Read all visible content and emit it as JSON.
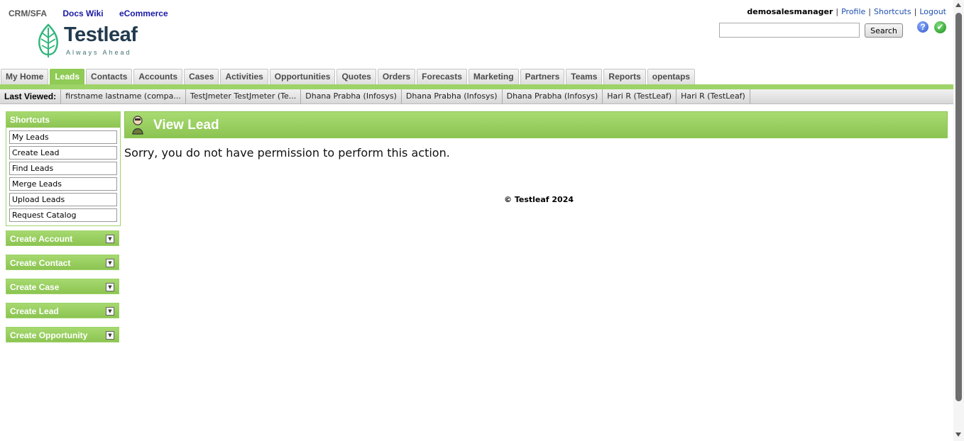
{
  "app_links": {
    "current": "CRM/SFA",
    "docs": "Docs Wiki",
    "ecommerce": "eCommerce"
  },
  "logo": {
    "name": "Testleaf",
    "tagline": "Always Ahead"
  },
  "user_menu": {
    "username": "demosalesmanager",
    "profile": "Profile",
    "shortcuts": "Shortcuts",
    "logout": "Logout",
    "separator": "|"
  },
  "search": {
    "value": "",
    "button_label": "Search"
  },
  "icons": {
    "help": "help-icon",
    "status": "check-icon",
    "help_glyph": "?",
    "status_glyph": "✔"
  },
  "tabs": [
    {
      "label": "My Home",
      "active": false
    },
    {
      "label": "Leads",
      "active": true
    },
    {
      "label": "Contacts",
      "active": false
    },
    {
      "label": "Accounts",
      "active": false
    },
    {
      "label": "Cases",
      "active": false
    },
    {
      "label": "Activities",
      "active": false
    },
    {
      "label": "Opportunities",
      "active": false
    },
    {
      "label": "Quotes",
      "active": false
    },
    {
      "label": "Orders",
      "active": false
    },
    {
      "label": "Forecasts",
      "active": false
    },
    {
      "label": "Marketing",
      "active": false
    },
    {
      "label": "Partners",
      "active": false
    },
    {
      "label": "Teams",
      "active": false
    },
    {
      "label": "Reports",
      "active": false
    },
    {
      "label": "opentaps",
      "active": false
    }
  ],
  "last_viewed": {
    "label": "Last Viewed:",
    "items": [
      "firstname lastname (compa...",
      "TestJmeter TestJmeter (Te...",
      "Dhana Prabha (Infosys)",
      "Dhana Prabha (Infosys)",
      "Dhana Prabha (Infosys)",
      "Hari R (TestLeaf)",
      "Hari R (TestLeaf)"
    ]
  },
  "sidebar": {
    "shortcuts_title": "Shortcuts",
    "shortcuts": [
      "My Leads",
      "Create Lead",
      "Find Leads",
      "Merge Leads",
      "Upload Leads",
      "Request Catalog"
    ],
    "collapsibles": [
      "Create Account",
      "Create Contact",
      "Create Case",
      "Create Lead",
      "Create Opportunity"
    ],
    "toggle_glyph": "▼"
  },
  "main": {
    "title": "View Lead",
    "message": "Sorry, you do not have permission to perform this action."
  },
  "footer": {
    "copyright": "© Testleaf 2024"
  },
  "colors": {
    "accent_green": "#8cc452",
    "link_blue": "#1f4fae"
  }
}
